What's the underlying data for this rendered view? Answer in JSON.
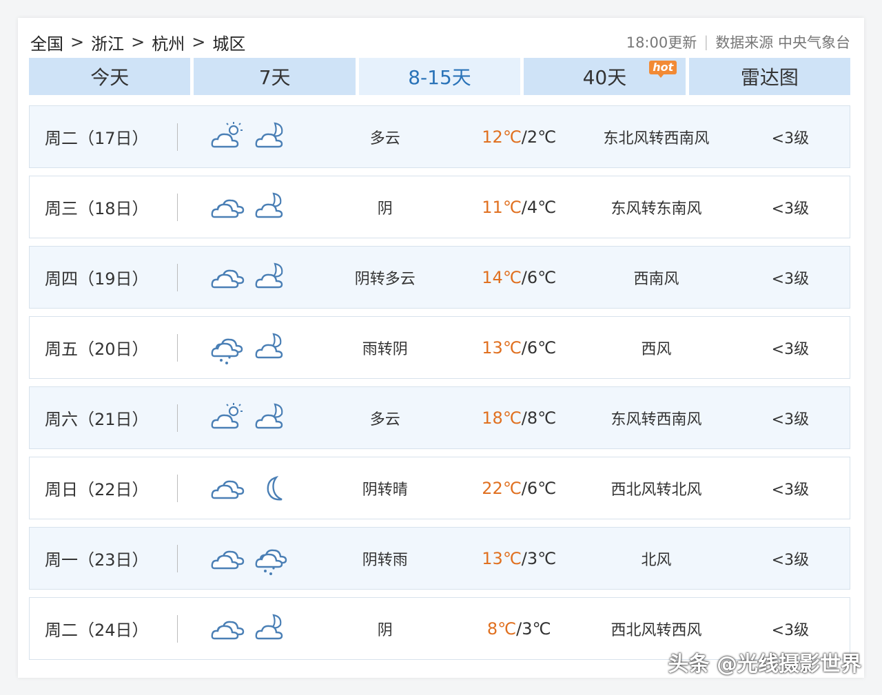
{
  "breadcrumb": {
    "items": [
      "全国",
      "浙江",
      "杭州",
      "城区"
    ],
    "separator": ">"
  },
  "meta": {
    "update": "18:00更新",
    "source": "数据来源 中央气象台"
  },
  "tabs": [
    {
      "label": "今天"
    },
    {
      "label": "7天"
    },
    {
      "label": "8-15天"
    },
    {
      "label": "40天",
      "badge": "hot"
    },
    {
      "label": "雷达图"
    }
  ],
  "active_tab": 2,
  "colors": {
    "accent": "#2a73b8",
    "tab_bg": "#cfe3f7",
    "high_temp": "#e07020",
    "icon_stroke": "#4a7fb5"
  },
  "forecast": [
    {
      "day": "周二（17日）",
      "icon_day": "partly-cloudy-day-icon",
      "icon_night": "partly-cloudy-night-icon",
      "condition": "多云",
      "high": "12℃",
      "low": "2℃",
      "wind": "东北风转西南风",
      "level": "<3级"
    },
    {
      "day": "周三（18日）",
      "icon_day": "overcast-icon",
      "icon_night": "overcast-night-icon",
      "condition": "阴",
      "high": "11℃",
      "low": "4℃",
      "wind": "东风转东南风",
      "level": "<3级"
    },
    {
      "day": "周四（19日）",
      "icon_day": "overcast-icon",
      "icon_night": "partly-cloudy-night-icon",
      "condition": "阴转多云",
      "high": "14℃",
      "low": "6℃",
      "wind": "西南风",
      "level": "<3级"
    },
    {
      "day": "周五（20日）",
      "icon_day": "rain-icon",
      "icon_night": "overcast-night-icon",
      "condition": "雨转阴",
      "high": "13℃",
      "low": "6℃",
      "wind": "西风",
      "level": "<3级"
    },
    {
      "day": "周六（21日）",
      "icon_day": "partly-cloudy-day-icon",
      "icon_night": "partly-cloudy-night-icon",
      "condition": "多云",
      "high": "18℃",
      "low": "8℃",
      "wind": "东风转西南风",
      "level": "<3级"
    },
    {
      "day": "周日（22日）",
      "icon_day": "overcast-icon",
      "icon_night": "clear-night-icon",
      "condition": "阴转晴",
      "high": "22℃",
      "low": "6℃",
      "wind": "西北风转北风",
      "level": "<3级"
    },
    {
      "day": "周一（23日）",
      "icon_day": "overcast-icon",
      "icon_night": "rain-icon",
      "condition": "阴转雨",
      "high": "13℃",
      "low": "3℃",
      "wind": "北风",
      "level": "<3级"
    },
    {
      "day": "周二（24日）",
      "icon_day": "overcast-icon",
      "icon_night": "overcast-night-icon",
      "condition": "阴",
      "high": "8℃",
      "low": "3℃",
      "wind": "西北风转西风",
      "level": "<3级"
    }
  ],
  "watermark": "头条 @光线摄影世界"
}
